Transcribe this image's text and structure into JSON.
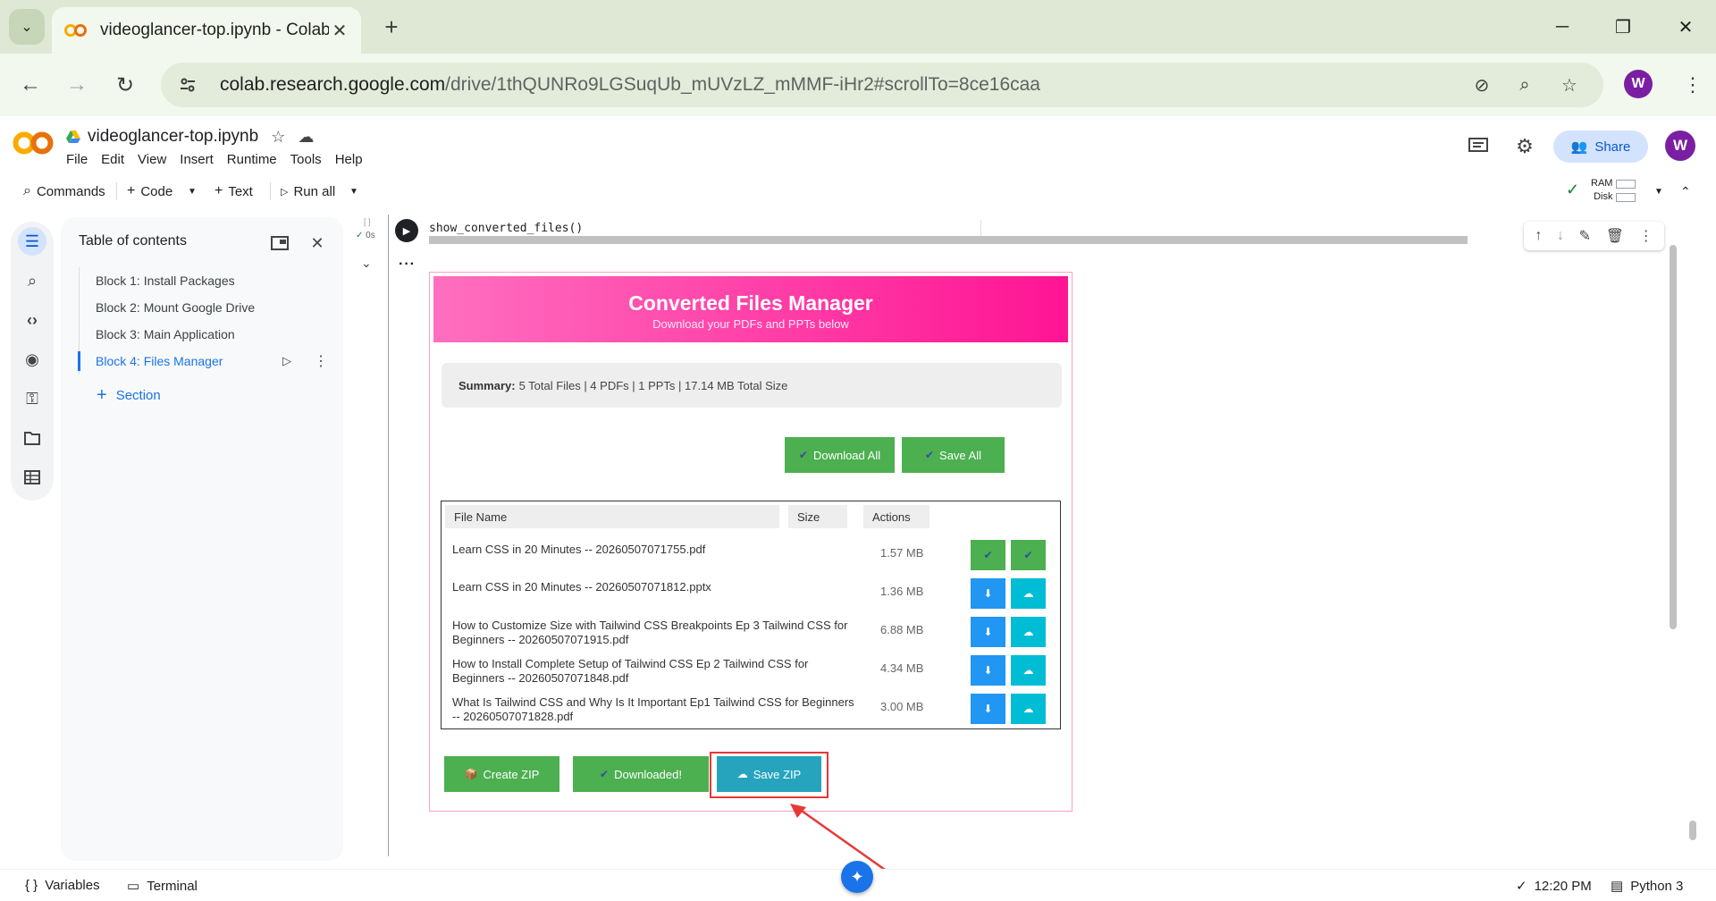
{
  "browser": {
    "tab_title": "videoglancer-top.ipynb - Colab",
    "url_host": "colab.research.google.com",
    "url_path": "/drive/1thQUNRo9LGSuqUb_mUVzLZ_mMMF-iHr2#scrollTo=8ce16caa",
    "profile_initial": "W"
  },
  "colab": {
    "notebook_title": "videoglancer-top.ipynb",
    "menu": [
      "File",
      "Edit",
      "View",
      "Insert",
      "Runtime",
      "Tools",
      "Help"
    ],
    "share_label": "Share",
    "avatar_initial": "W",
    "toolbar": {
      "commands": "Commands",
      "code": "Code",
      "text": "Text",
      "run_all": "Run all",
      "ram": "RAM",
      "disk": "Disk"
    }
  },
  "toc": {
    "title": "Table of contents",
    "items": [
      {
        "label": "Block 1: Install Packages"
      },
      {
        "label": "Block 2: Mount Google Drive"
      },
      {
        "label": "Block 3: Main Application"
      },
      {
        "label": "Block 4: Files Manager"
      }
    ],
    "add_section": "Section"
  },
  "cell": {
    "status_time": "0s",
    "code": "show_converted_files()"
  },
  "files_manager": {
    "title": "Converted Files Manager",
    "subtitle": "Download your PDFs and PPTs below",
    "summary_label": "Summary:",
    "summary_text": "5 Total Files | 4 PDFs | 1 PPTs | 17.14 MB Total Size",
    "download_all": "Download All",
    "save_all": "Save All",
    "columns": [
      "File Name",
      "Size",
      "Actions"
    ],
    "files": [
      {
        "name": "Learn CSS in 20 Minutes -- 20260507071755.pdf",
        "size": "1.57 MB"
      },
      {
        "name": "Learn CSS in 20 Minutes -- 20260507071812.pptx",
        "size": "1.36 MB"
      },
      {
        "name": "How to Customize Size with Tailwind CSS Breakpoints Ep 3 Tailwind CSS for Beginners -- 20260507071915.pdf",
        "size": "6.88 MB"
      },
      {
        "name": "How to Install Complete Setup of Tailwind CSS Ep 2 Tailwind CSS for Beginners -- 20260507071848.pdf",
        "size": "4.34 MB"
      },
      {
        "name": "What Is Tailwind CSS and Why Is It Important Ep1 Tailwind CSS for Beginners -- 20260507071828.pdf",
        "size": "3.00 MB"
      }
    ],
    "create_zip": "Create ZIP",
    "downloaded": "Downloaded!",
    "save_zip": "Save ZIP",
    "colors": {
      "header_start": "#ff6fbf",
      "header_end": "#ff1493",
      "green": "#4caf50",
      "blue": "#2196f3",
      "cyan": "#00bcd4",
      "save_zip_bg": "#26a4bd"
    }
  },
  "statusbar": {
    "variables": "Variables",
    "terminal": "Terminal",
    "time": "12:20 PM",
    "runtime": "Python 3"
  }
}
